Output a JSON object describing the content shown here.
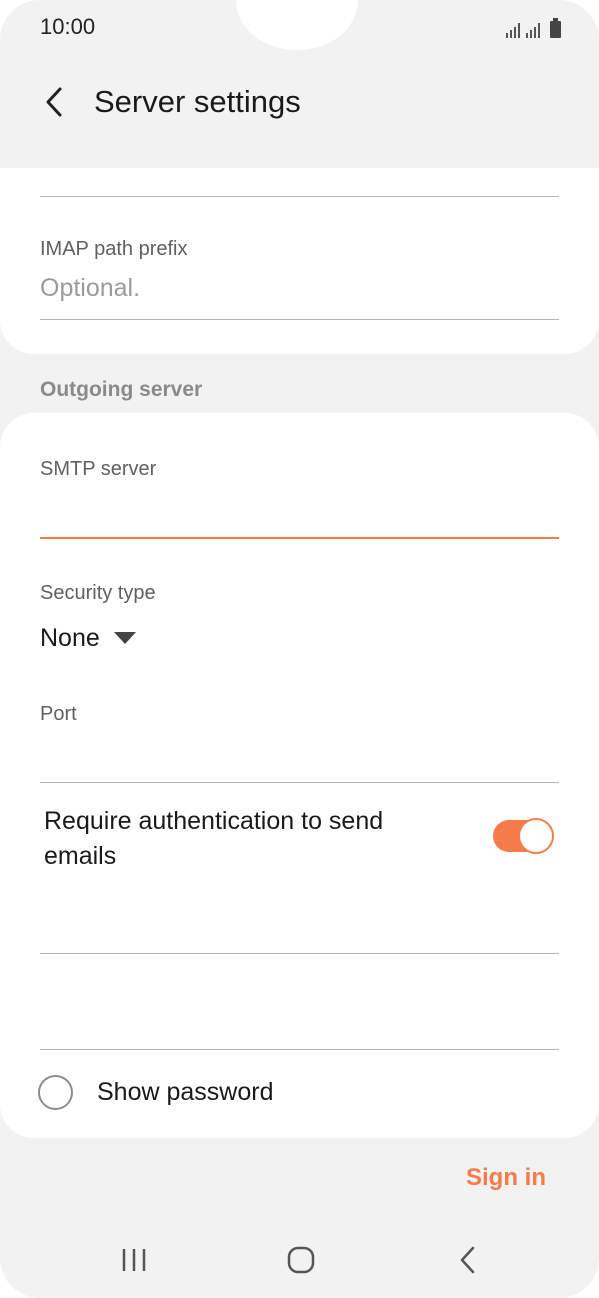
{
  "status_bar": {
    "time": "10:00"
  },
  "header": {
    "title": "Server settings"
  },
  "incoming": {
    "imap_prefix_label": "IMAP path prefix",
    "imap_prefix_placeholder": "Optional."
  },
  "outgoing": {
    "section_title": "Outgoing server",
    "smtp_label": "SMTP server",
    "smtp_value": "",
    "security_label": "Security type",
    "security_value": "None",
    "port_label": "Port",
    "port_value": "",
    "auth_label": "Require authentication to send emails",
    "auth_enabled": true,
    "show_password_label": "Show password",
    "show_password_checked": false
  },
  "actions": {
    "sign_in_label": "Sign in"
  },
  "nav": {
    "icons": [
      "recent-apps-icon",
      "home-icon",
      "back-icon"
    ]
  },
  "colors": {
    "accent": "#f47b4a",
    "background": "#f2f2f2",
    "card": "#ffffff"
  }
}
